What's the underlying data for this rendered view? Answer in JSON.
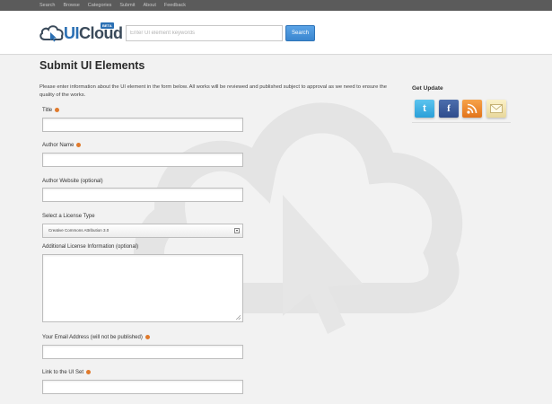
{
  "topnav": {
    "items": [
      "Search",
      "Browse",
      "Categories",
      "Submit",
      "About",
      "Feedback"
    ]
  },
  "header": {
    "logo_ui": "UI",
    "logo_cloud": "Cloud",
    "logo_badge": "BETA",
    "search_placeholder": "Enter UI element keywords",
    "search_button": "Search"
  },
  "main": {
    "title": "Submit UI Elements",
    "intro": "Please enter information about the UI element in the form below. All works will be reviewed and published subject to approval as we need to ensure the quality of the works.",
    "fields": {
      "title_label": "Title",
      "author_label": "Author Name",
      "website_label": "Author Website (optional)",
      "license_label": "Select a License Type",
      "license_value": "Creative Commons Attribution 3.0",
      "license_info_label": "Additional License Information (optional)",
      "email_label": "Your Email Address (will not be published)",
      "link_label": "Link to the UI Set"
    }
  },
  "sidebar": {
    "title": "Get Update",
    "social_icons": [
      "twitter-icon",
      "facebook-icon",
      "rss-icon",
      "mail-icon"
    ]
  },
  "colors": {
    "accent": "#2a6fb3",
    "required_dot": "#e07a2c",
    "nav_bg": "#5b5b5b"
  }
}
